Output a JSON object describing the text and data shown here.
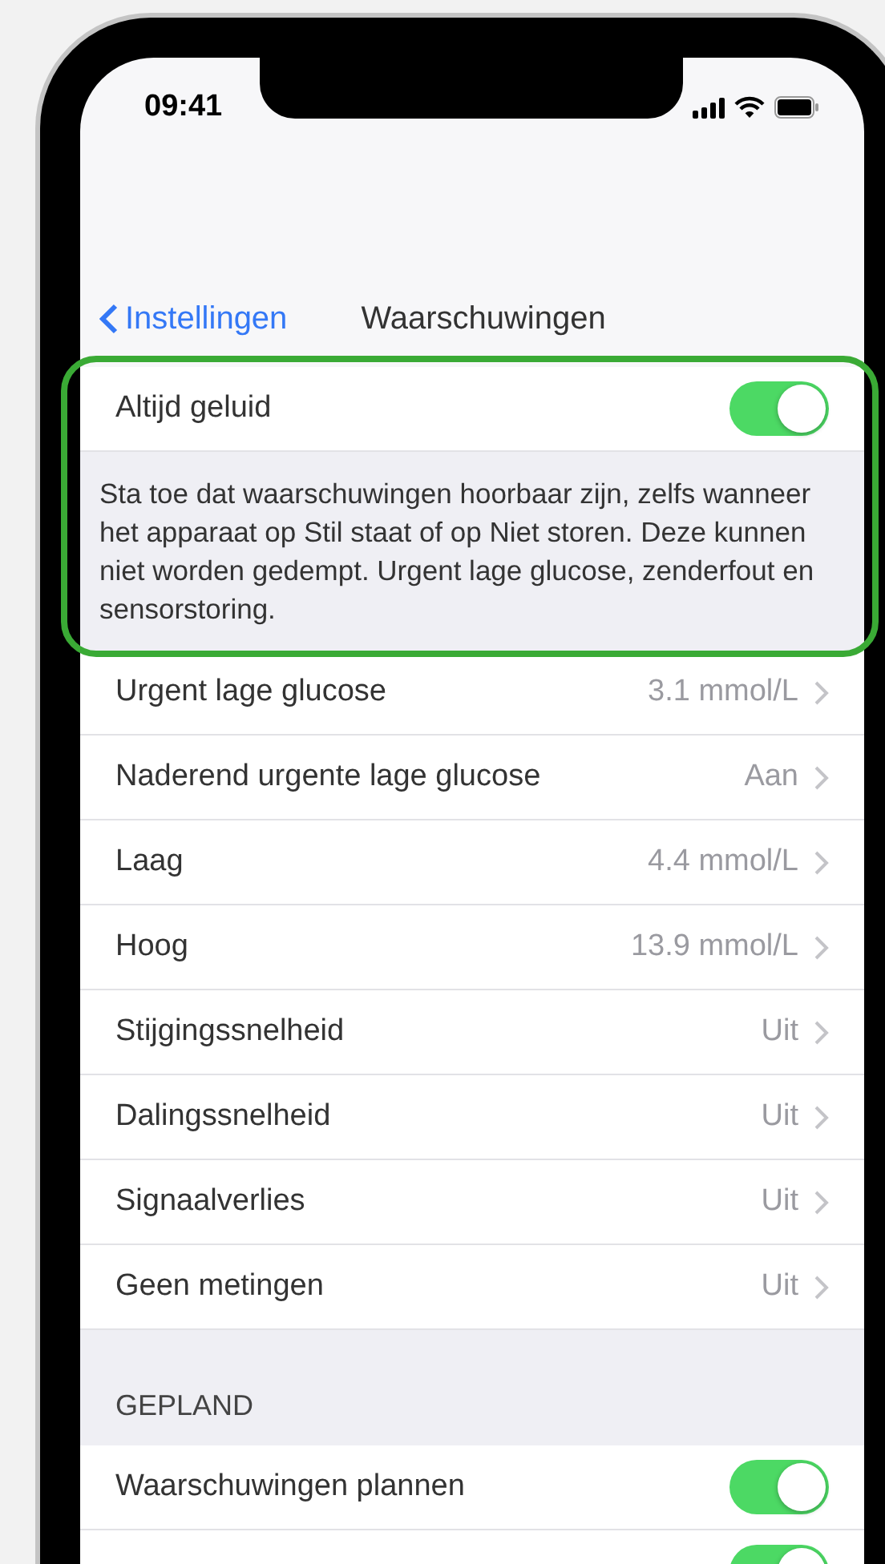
{
  "status_bar": {
    "time": "09:41"
  },
  "nav": {
    "back": "Instellingen",
    "title": "Waarschuwingen"
  },
  "always_sound": {
    "label": "Altijd geluid",
    "on": true,
    "description": "Sta toe dat waarschuwingen hoorbaar zijn, zelfs wanneer het apparaat op Stil staat of op Niet storen. Deze kunnen niet worden gedempt. Urgent lage glucose, zenderfout en sensorstoring."
  },
  "alerts": [
    {
      "label": "Urgent lage glucose",
      "value": "3.1 mmol/L"
    },
    {
      "label": "Naderend urgente lage glucose",
      "value": "Aan"
    },
    {
      "label": "Laag",
      "value": "4.4 mmol/L"
    },
    {
      "label": "Hoog",
      "value": "13.9 mmol/L"
    },
    {
      "label": "Stijgingssnelheid",
      "value": "Uit"
    },
    {
      "label": "Dalingssnelheid",
      "value": "Uit"
    },
    {
      "label": "Signaalverlies",
      "value": "Uit"
    },
    {
      "label": "Geen metingen",
      "value": "Uit"
    }
  ],
  "scheduled": {
    "header": "GEPLAND",
    "items": [
      {
        "label": "Waarschuwingen plannen",
        "on": true
      },
      {
        "on": true
      }
    ]
  }
}
